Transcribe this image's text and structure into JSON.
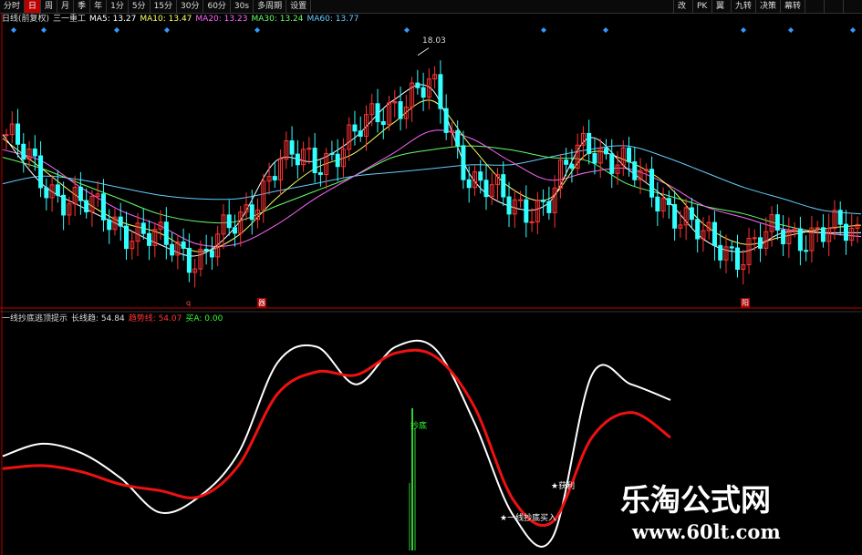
{
  "toolbar": {
    "left": [
      {
        "label": "分时",
        "active": false
      },
      {
        "label": "日",
        "active": true
      },
      {
        "label": "周",
        "active": false
      },
      {
        "label": "月",
        "active": false
      },
      {
        "label": "季",
        "active": false
      },
      {
        "label": "年",
        "active": false
      },
      {
        "label": "1分",
        "active": false
      },
      {
        "label": "5分",
        "active": false
      },
      {
        "label": "15分",
        "active": false
      },
      {
        "label": "30分",
        "active": false
      },
      {
        "label": "60分",
        "active": false
      },
      {
        "label": "30s",
        "active": false
      },
      {
        "label": "多周期",
        "active": false
      },
      {
        "label": "设置",
        "active": false
      }
    ],
    "right": [
      "改",
      "PK",
      "翼",
      "九转",
      "决策",
      "幕转",
      "",
      "",
      ""
    ]
  },
  "price_legend": [
    {
      "text": "日线(前复权)",
      "color": "#dddddd"
    },
    {
      "text": "三一重工",
      "color": "#dddddd"
    },
    {
      "text": "MA5: 13.27",
      "color": "#ffffff"
    },
    {
      "text": "MA10: 13.47",
      "color": "#ffff66"
    },
    {
      "text": "MA20: 13.23",
      "color": "#ff66ff"
    },
    {
      "text": "MA30: 13.24",
      "color": "#66ff66"
    },
    {
      "text": "MA60: 13.77",
      "color": "#66ccff"
    }
  ],
  "indicator_legend": [
    {
      "text": "一线抄底逃顶提示",
      "color": "#dddddd"
    },
    {
      "text": "长线趋: 54.84",
      "color": "#dddddd"
    },
    {
      "text": "趋势线: 54.07",
      "color": "#ff3333"
    },
    {
      "text": "买A: 0.00",
      "color": "#33ff33"
    }
  ],
  "annotations": {
    "max_price": "18.03",
    "buy_signal": "抄底",
    "sell_signal": "★获利",
    "bottom_signal": "★一线抄底买入"
  },
  "markers": {
    "low_flag": "q",
    "box_a": "器",
    "box_b": "阳"
  },
  "watermark": {
    "line1": "乐淘公式网",
    "line2": "www.60lt.com"
  },
  "colors": {
    "up": "#ff3333",
    "down": "#33ffff",
    "ma5": "#ffffff",
    "ma10": "#ffff66",
    "ma20": "#ff66ff",
    "ma30": "#66ff66",
    "ma60": "#66ccff",
    "long_line": "#ffffff",
    "trend_line": "#ee1111",
    "buy_bar": "#33cc33",
    "diamond": "#3399ff"
  },
  "chart_data": [
    {
      "type": "line",
      "title": "日线(前复权) 三一重工",
      "annotations": [
        "18.03"
      ],
      "series": [
        {
          "name": "MA60",
          "values": [
            14.6,
            14.8,
            14.7,
            14.5,
            14.3,
            14.2,
            14.2,
            14.4,
            14.6,
            14.8,
            14.9,
            15.0,
            15.1,
            15.1,
            15.3,
            15.5,
            15.6,
            15.3,
            14.9,
            14.5,
            14.2,
            13.9,
            13.8
          ]
        },
        {
          "name": "MA30",
          "values": [
            15.3,
            15.0,
            14.6,
            14.2,
            13.8,
            13.6,
            13.6,
            14.0,
            14.4,
            14.8,
            15.3,
            15.5,
            15.6,
            15.5,
            15.3,
            15.2,
            14.6,
            14.3,
            14.0,
            13.8,
            13.5,
            13.3,
            13.2
          ]
        },
        {
          "name": "MA20",
          "values": [
            15.5,
            15.2,
            14.5,
            13.9,
            13.5,
            13.0,
            13.0,
            13.5,
            14.2,
            14.8,
            15.4,
            16.0,
            15.8,
            15.2,
            14.7,
            14.9,
            15.0,
            14.6,
            14.0,
            13.7,
            13.4,
            13.3,
            13.2
          ]
        },
        {
          "name": "MA10",
          "values": [
            15.8,
            15.0,
            14.2,
            13.6,
            13.3,
            12.8,
            13.2,
            14.2,
            15.0,
            15.4,
            16.2,
            16.8,
            15.6,
            14.5,
            14.2,
            15.4,
            15.2,
            14.6,
            13.5,
            13.0,
            13.2,
            13.4,
            13.5
          ]
        },
        {
          "name": "MA5",
          "values": [
            15.9,
            14.6,
            14.0,
            13.5,
            13.0,
            12.7,
            13.5,
            15.2,
            15.2,
            15.8,
            16.8,
            17.1,
            14.8,
            14.0,
            14.1,
            15.8,
            15.0,
            14.2,
            13.1,
            12.8,
            13.3,
            13.3,
            13.3
          ]
        }
      ]
    },
    {
      "type": "line",
      "title": "一线抄底逃顶提示",
      "ylim": [
        0,
        100
      ],
      "series": [
        {
          "name": "长线趋",
          "values": [
            18,
            26,
            20,
            4,
            -18,
            -8,
            20,
            78,
            88,
            64,
            88,
            87,
            40,
            -20,
            -34,
            70,
            64,
            54
          ]
        },
        {
          "name": "趋势线",
          "values": [
            10,
            12,
            8,
            0,
            -4,
            -8,
            12,
            58,
            72,
            70,
            84,
            82,
            50,
            -10,
            -24,
            30,
            46,
            30
          ]
        },
        {
          "name": "买A",
          "values": [
            0,
            0,
            0,
            0,
            0,
            0,
            0,
            0,
            0,
            0,
            0,
            0,
            0,
            0,
            0,
            0,
            0,
            0
          ]
        }
      ]
    }
  ]
}
